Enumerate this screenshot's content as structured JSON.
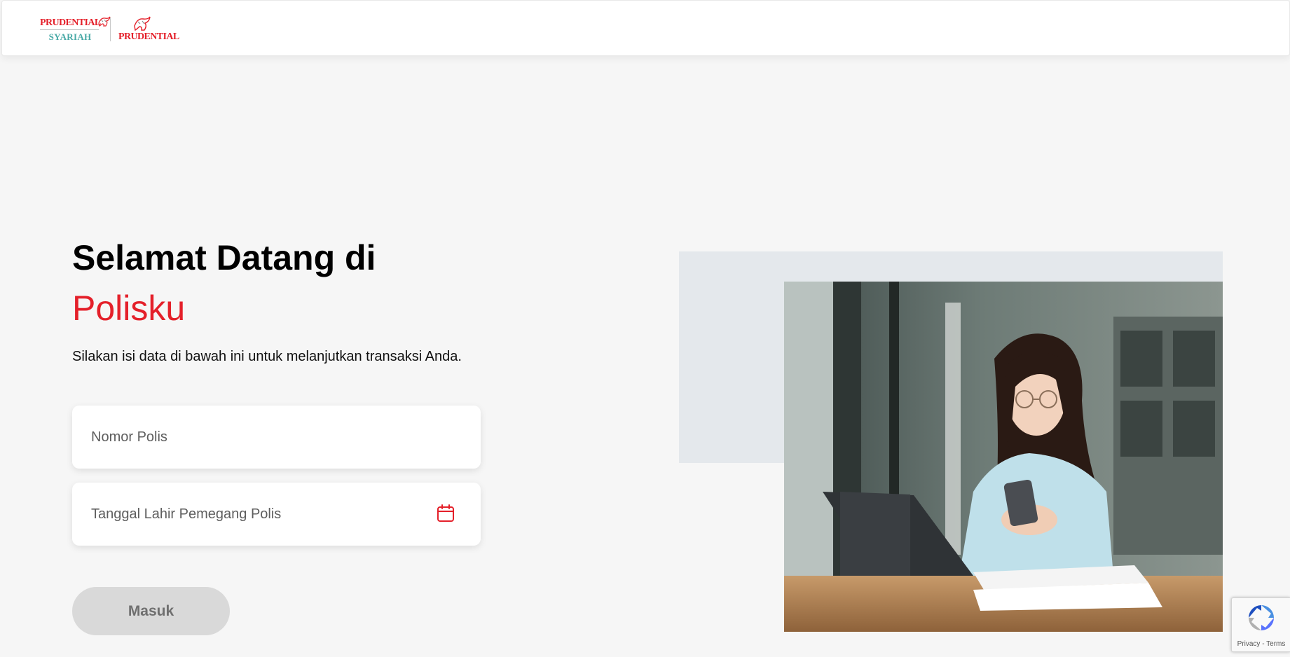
{
  "header": {
    "logo_syariah": {
      "brand": "PRUDENTIAL",
      "sub": "SYARIAH"
    },
    "logo_prudential": {
      "brand": "PRUDENTIAL"
    }
  },
  "welcome": {
    "title": "Selamat Datang di",
    "brand": "Polisku",
    "instructions": "Silakan isi data di bawah ini untuk melanjutkan transaksi Anda."
  },
  "form": {
    "policy_number_placeholder": "Nomor Polis",
    "dob_placeholder": "Tanggal Lahir Pemegang Polis",
    "submit_label": "Masuk",
    "submit_enabled": false
  },
  "recaptcha": {
    "privacy_label": "Privacy",
    "separator": "-",
    "terms_label": "Terms"
  },
  "colors": {
    "brand_red": "#e4202a",
    "syariah_teal": "#48a9a6",
    "button_disabled_bg": "#d9d9d9",
    "page_bg": "#f6f6f6",
    "hero_backdrop": "#e4e8ec"
  },
  "icons": {
    "calendar": "calendar-icon",
    "recaptcha": "recaptcha-icon"
  }
}
